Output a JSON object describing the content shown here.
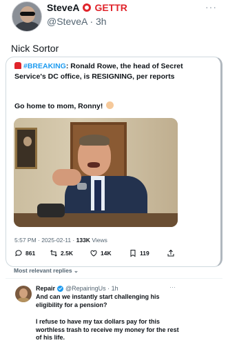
{
  "outer_post": {
    "name": "SteveA",
    "platform": "GETTR",
    "handle_time": "@SteveA · 3h",
    "more": "···",
    "text": "Nick Sortor"
  },
  "quoted_post": {
    "hashtag": "#BREAKING",
    "text": ": Ronald Rowe, the head of Secret Service's DC office, is RESIGNING, per reports",
    "text2": "Go home to mom, Ronny!",
    "meta_time": "5:57 PM · 2025-02-11 · ",
    "views_count": "133K",
    "views_label": " Views",
    "actions": {
      "replies": "861",
      "reposts": "2.5K",
      "likes": "14K",
      "bookmarks": "119"
    }
  },
  "replies_filter": "Most relevant replies ⌄",
  "reply": {
    "name": "Repair",
    "handle_time": "@RepairingUs · 1h",
    "more": "···",
    "text": "And can we instantly start challenging his eligibility for a pension?",
    "text2": "I refuse to have my tax dollars pay for this worthless trash to receive my money for the rest of his life."
  },
  "icons": {
    "platform_logo": "gettr-logo-icon",
    "siren": "siren-emoji-icon",
    "clap": "clapping-hands-emoji-icon",
    "reply": "reply-icon",
    "repost": "repost-icon",
    "like": "heart-icon",
    "bookmark": "bookmark-icon",
    "share": "share-icon",
    "verified": "verified-badge-icon"
  },
  "colors": {
    "accent": "#1d9bf0",
    "brand_red": "#e0242b",
    "muted_text": "#536471"
  }
}
